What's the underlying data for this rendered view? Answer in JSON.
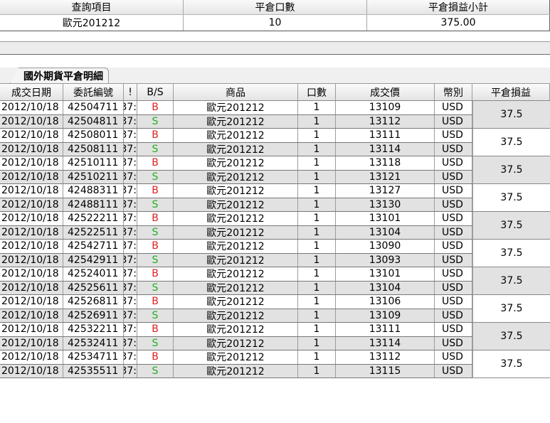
{
  "summary": {
    "headers": [
      "查詢項目",
      "平倉口數",
      "平倉損益小計"
    ],
    "values": [
      "歐元201212",
      "10",
      "375.00"
    ]
  },
  "tab": {
    "label": "國外期貨平倉明細"
  },
  "detail": {
    "headers": [
      "成交日期",
      "委託編號",
      "!",
      "B/S",
      "商品",
      "口數",
      "成交價",
      "幣別",
      "平倉損益"
    ],
    "rows": [
      {
        "date": "2012/10/18",
        "order": "42504711",
        "t": "37:",
        "bs": "B",
        "product": "歐元201212",
        "lots": "1",
        "price": "13109",
        "cur": "USD"
      },
      {
        "date": "2012/10/18",
        "order": "42504811",
        "t": "37:",
        "bs": "S",
        "product": "歐元201212",
        "lots": "1",
        "price": "13112",
        "cur": "USD"
      },
      {
        "date": "2012/10/18",
        "order": "42508011",
        "t": "37:",
        "bs": "B",
        "product": "歐元201212",
        "lots": "1",
        "price": "13111",
        "cur": "USD"
      },
      {
        "date": "2012/10/18",
        "order": "42508111",
        "t": "37:",
        "bs": "S",
        "product": "歐元201212",
        "lots": "1",
        "price": "13114",
        "cur": "USD"
      },
      {
        "date": "2012/10/18",
        "order": "42510111",
        "t": "37:",
        "bs": "B",
        "product": "歐元201212",
        "lots": "1",
        "price": "13118",
        "cur": "USD"
      },
      {
        "date": "2012/10/18",
        "order": "42510211",
        "t": "37:",
        "bs": "S",
        "product": "歐元201212",
        "lots": "1",
        "price": "13121",
        "cur": "USD"
      },
      {
        "date": "2012/10/18",
        "order": "42488311",
        "t": "37:",
        "bs": "B",
        "product": "歐元201212",
        "lots": "1",
        "price": "13127",
        "cur": "USD"
      },
      {
        "date": "2012/10/18",
        "order": "42488111",
        "t": "37:",
        "bs": "S",
        "product": "歐元201212",
        "lots": "1",
        "price": "13130",
        "cur": "USD"
      },
      {
        "date": "2012/10/18",
        "order": "42522211",
        "t": "37:",
        "bs": "B",
        "product": "歐元201212",
        "lots": "1",
        "price": "13101",
        "cur": "USD"
      },
      {
        "date": "2012/10/18",
        "order": "42522511",
        "t": "37:",
        "bs": "S",
        "product": "歐元201212",
        "lots": "1",
        "price": "13104",
        "cur": "USD"
      },
      {
        "date": "2012/10/18",
        "order": "42542711",
        "t": "37:",
        "bs": "B",
        "product": "歐元201212",
        "lots": "1",
        "price": "13090",
        "cur": "USD"
      },
      {
        "date": "2012/10/18",
        "order": "42542911",
        "t": "37:",
        "bs": "S",
        "product": "歐元201212",
        "lots": "1",
        "price": "13093",
        "cur": "USD"
      },
      {
        "date": "2012/10/18",
        "order": "42524011",
        "t": "37:",
        "bs": "B",
        "product": "歐元201212",
        "lots": "1",
        "price": "13101",
        "cur": "USD"
      },
      {
        "date": "2012/10/18",
        "order": "42525611",
        "t": "37:",
        "bs": "S",
        "product": "歐元201212",
        "lots": "1",
        "price": "13104",
        "cur": "USD"
      },
      {
        "date": "2012/10/18",
        "order": "42526811",
        "t": "37:",
        "bs": "B",
        "product": "歐元201212",
        "lots": "1",
        "price": "13106",
        "cur": "USD"
      },
      {
        "date": "2012/10/18",
        "order": "42526911",
        "t": "37:",
        "bs": "S",
        "product": "歐元201212",
        "lots": "1",
        "price": "13109",
        "cur": "USD"
      },
      {
        "date": "2012/10/18",
        "order": "42532211",
        "t": "37:",
        "bs": "B",
        "product": "歐元201212",
        "lots": "1",
        "price": "13111",
        "cur": "USD"
      },
      {
        "date": "2012/10/18",
        "order": "42532411",
        "t": "37:",
        "bs": "S",
        "product": "歐元201212",
        "lots": "1",
        "price": "13114",
        "cur": "USD"
      },
      {
        "date": "2012/10/18",
        "order": "42534711",
        "t": "37:",
        "bs": "B",
        "product": "歐元201212",
        "lots": "1",
        "price": "13112",
        "cur": "USD"
      },
      {
        "date": "2012/10/18",
        "order": "42535511",
        "t": "37:",
        "bs": "S",
        "product": "歐元201212",
        "lots": "1",
        "price": "13115",
        "cur": "USD"
      }
    ],
    "pnl": [
      "37.5",
      "37.5",
      "37.5",
      "37.5",
      "37.5",
      "37.5",
      "37.5",
      "37.5",
      "37.5",
      "37.5"
    ]
  },
  "colors": {
    "buy": "#e02020",
    "sell": "#20b020",
    "row_alt": "#e2e2e2"
  }
}
